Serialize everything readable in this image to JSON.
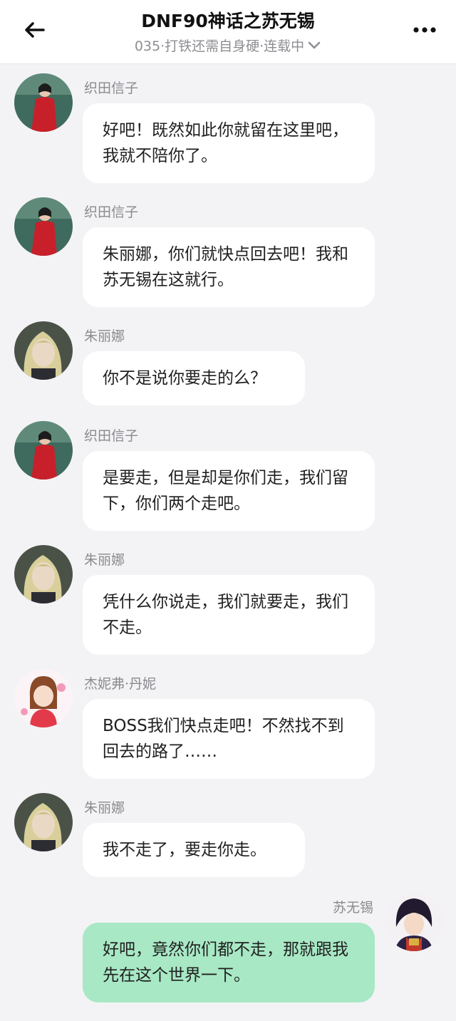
{
  "header": {
    "title": "DNF90神话之苏无锡",
    "subtitle": "035·打铁还需自身硬·连载中",
    "back_icon": "arrow-left-icon",
    "more_icon": "more-horizontal-icon",
    "dropdown_icon": "chevron-down-icon"
  },
  "messages": [
    {
      "sender": "织田信子",
      "text": "好吧！既然如此你就留在这里吧，我就不陪你了。"
    },
    {
      "sender": "织田信子",
      "text": "朱丽娜，你们就快点回去吧！我和苏无锡在这就行。"
    },
    {
      "sender": "朱丽娜",
      "text": "你不是说你要走的么？"
    },
    {
      "sender": "织田信子",
      "text": "是要走，但是却是你们走，我们留下，你们两个走吧。"
    },
    {
      "sender": "朱丽娜",
      "text": "凭什么你说走，我们就要走，我们不走。"
    },
    {
      "sender": "杰妮弗·丹妮",
      "text": "BOSS我们快点走吧！不然找不到回去的路了……"
    },
    {
      "sender": "朱丽娜",
      "text": "我不走了，要走你走。"
    },
    {
      "sender": "苏无锡",
      "text": "好吧，竟然你们都不走，那就跟我先在这个世界一下。"
    }
  ],
  "colors": {
    "background": "#f3f3f5",
    "bubble_other": "#ffffff",
    "bubble_self": "#a8e8c5",
    "name_text": "#8a8a8f"
  }
}
